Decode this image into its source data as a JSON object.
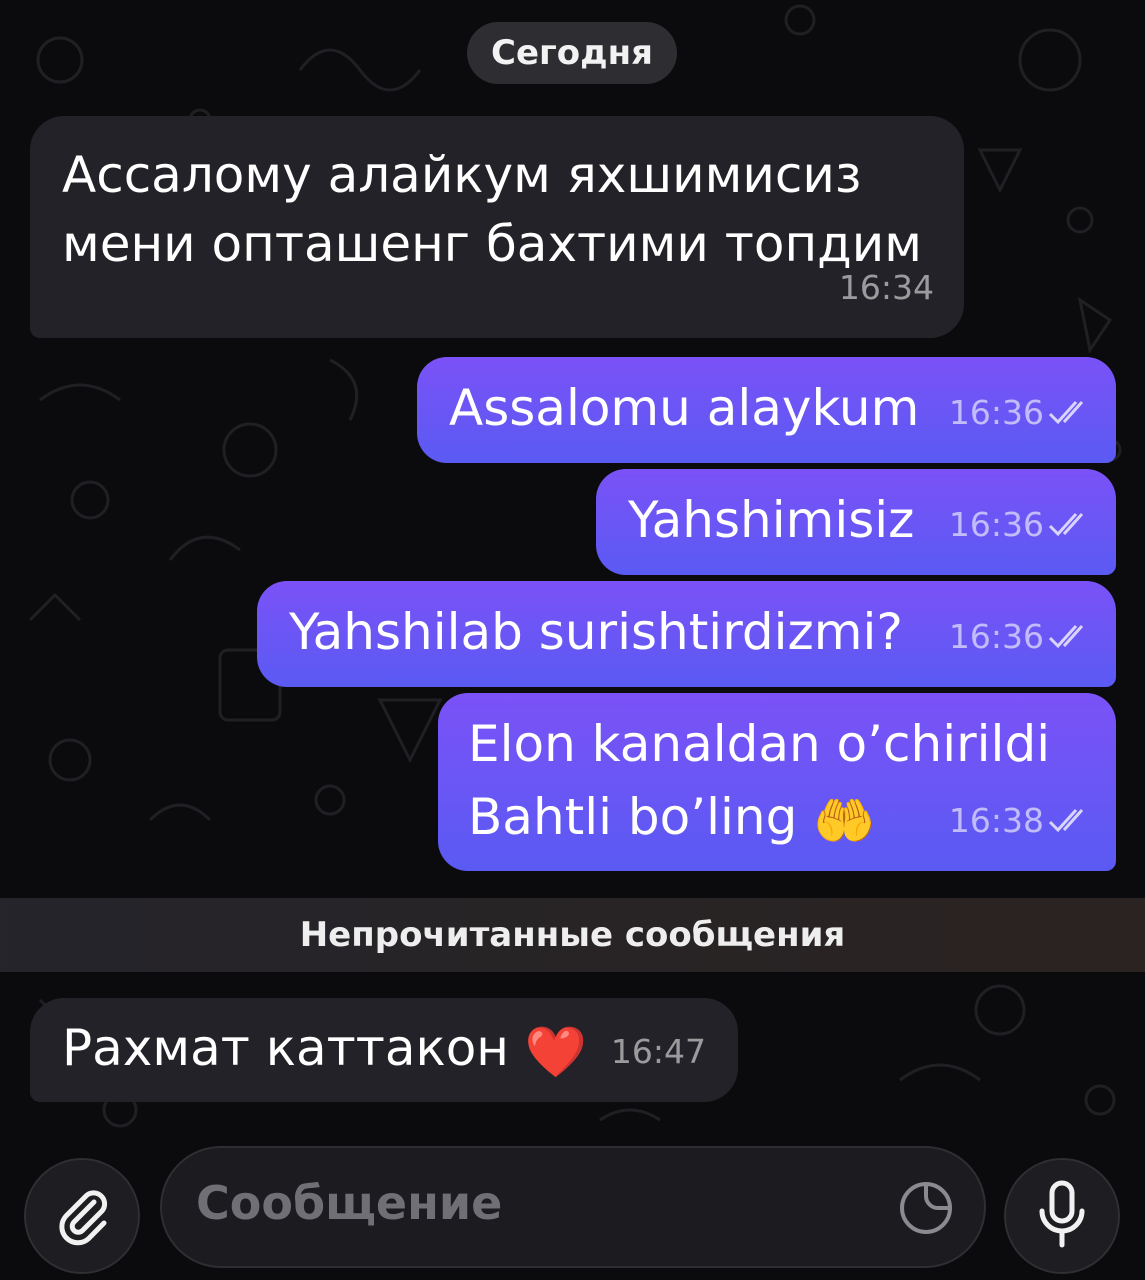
{
  "chat": {
    "date_label": "Сегодня",
    "unread_label": "Непрочитанные сообщения"
  },
  "messages": [
    {
      "direction": "incoming",
      "lines": [
        "Ассалому алайкум яхшимисиз",
        "мени опташенг бахтими топдим"
      ],
      "time": "16:34"
    },
    {
      "direction": "outgoing",
      "text": "Assalomu alaykum",
      "time": "16:36",
      "status": "read"
    },
    {
      "direction": "outgoing",
      "text": "Yahshimisiz",
      "time": "16:36",
      "status": "read"
    },
    {
      "direction": "outgoing",
      "text": "Yahshilab surishtirdizmi?",
      "time": "16:36",
      "status": "read"
    },
    {
      "direction": "outgoing",
      "lines": [
        "Elon kanaldan o’chirildi",
        "Bahtli bo’ling"
      ],
      "emoji": "🤲",
      "time": "16:38",
      "status": "read"
    },
    {
      "direction": "incoming",
      "text": "Рахмат каттакон",
      "emoji": "❤️",
      "time": "16:47"
    }
  ],
  "composer": {
    "placeholder": "Сообщение",
    "attach_icon": "paperclip-icon",
    "sticker_icon": "sticker-icon",
    "mic_icon": "microphone-icon"
  },
  "colors": {
    "outgoing_top": "#7b52f7",
    "outgoing_bottom": "#5a5af3",
    "incoming": "#232228",
    "background": "#0b0b0d"
  }
}
